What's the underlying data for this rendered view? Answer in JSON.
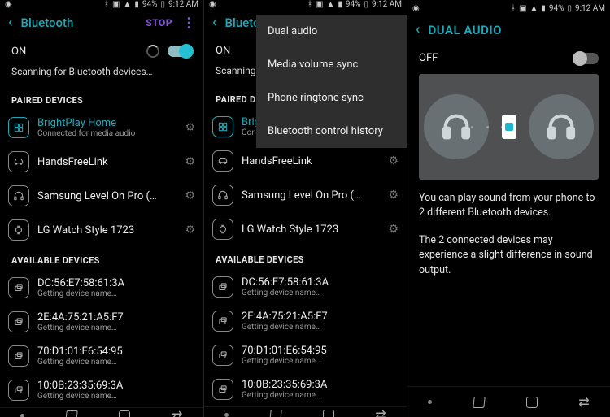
{
  "status": {
    "battery": "94%",
    "time": "9:12 AM"
  },
  "screen1": {
    "title": "Bluetooth",
    "stop": "STOP",
    "toggle": "ON",
    "scan": "Scanning for Bluetooth devices…",
    "section_paired": "PAIRED DEVICES",
    "section_avail": "AVAILABLE DEVICES",
    "paired": [
      {
        "name": "BrightPlay Home",
        "sub": "Connected for media audio"
      },
      {
        "name": "HandsFreeLink",
        "sub": ""
      },
      {
        "name": "Samsung Level On Pro (…",
        "sub": ""
      },
      {
        "name": "LG Watch Style 1723",
        "sub": ""
      }
    ],
    "avail": [
      {
        "name": "DC:56:E7:58:61:3A",
        "sub": "Getting device name…"
      },
      {
        "name": "2E:4A:75:21:A5:F7",
        "sub": "Getting device name…"
      },
      {
        "name": "70:D1:01:E6:54:95",
        "sub": "Getting device name…"
      },
      {
        "name": "10:0B:23:35:69:3A",
        "sub": "Getting device name…"
      }
    ]
  },
  "screen2": {
    "menu": [
      "Dual audio",
      "Media volume sync",
      "Phone ringtone sync",
      "Bluetooth control history"
    ]
  },
  "screen3": {
    "title": "DUAL AUDIO",
    "toggle": "OFF",
    "p1": "You can play sound from your phone to 2 different Bluetooth devices.",
    "p2": "The 2 connected devices may experience a slight difference in sound output."
  }
}
